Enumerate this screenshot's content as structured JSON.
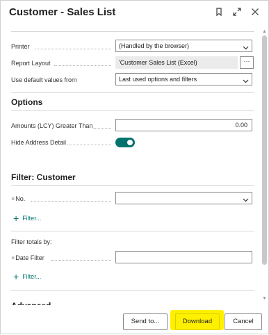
{
  "dialog": {
    "title": "Customer - Sales List",
    "icons": [
      "bookmark-icon",
      "expand-icon",
      "close-icon"
    ]
  },
  "fields": {
    "printer": {
      "label": "Printer",
      "value": "(Handled by the browser)"
    },
    "report_layout": {
      "label": "Report Layout",
      "value": "'Customer Sales List (Excel)",
      "assist": "···"
    },
    "use_defaults": {
      "label": "Use default values from",
      "value": "Last used options and filters"
    }
  },
  "options": {
    "title": "Options",
    "amounts": {
      "label": "Amounts (LCY) Greater Than",
      "value": "0.00"
    },
    "hide_address": {
      "label": "Hide Address Detail",
      "checked": true
    }
  },
  "filter_customer": {
    "title": "Filter: Customer",
    "no_label": "No.",
    "no_value": "",
    "add_filter": "Filter..."
  },
  "filter_totals": {
    "title": "Filter totals by:",
    "date_label": "Date Filter",
    "date_value": "",
    "add_filter": "Filter..."
  },
  "buttons": {
    "send_to": "Send to...",
    "download": "Download",
    "cancel": "Cancel"
  },
  "colors": {
    "accent": "#00736f",
    "highlight": "#fff000"
  }
}
